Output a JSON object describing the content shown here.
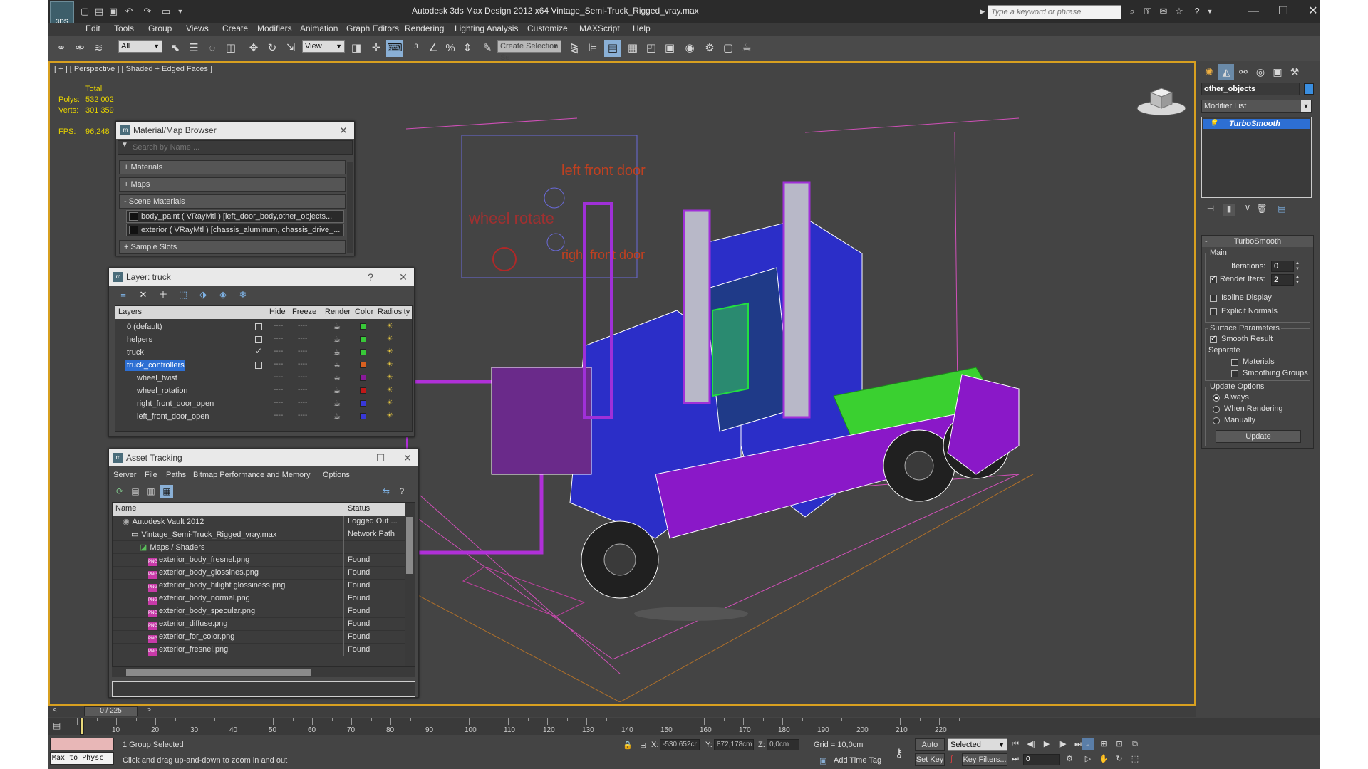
{
  "titlebar": {
    "title": "Autodesk 3ds Max Design 2012 x64      Vintage_Semi-Truck_Rigged_vray.max",
    "search_placeholder": "Type a keyword or phrase",
    "logo_text": "3DS"
  },
  "menu": [
    "Edit",
    "Tools",
    "Group",
    "Views",
    "Create",
    "Modifiers",
    "Animation",
    "Graph Editors",
    "Rendering",
    "Lighting Analysis",
    "Customize",
    "MAXScript",
    "Help"
  ],
  "toolbar": {
    "selection_filter": "All",
    "reference_coord": "View",
    "named_selection": "Create Selection Se"
  },
  "viewport": {
    "label": "[ + ] [ Perspective ] [ Shaded + Edged Faces ]",
    "stats": {
      "header": "Total",
      "polys_label": "Polys:",
      "polys_value": "532 002",
      "verts_label": "Verts:",
      "verts_value": "301 359",
      "fps_label": "FPS:",
      "fps_value": "96,248"
    },
    "annotations": {
      "left_front_door": "left front door",
      "wheel_rotate": "wheel rotate",
      "right_front_door": "right front door"
    }
  },
  "material_browser": {
    "title": "Material/Map Browser",
    "search_placeholder": "Search by Name ...",
    "sections": [
      "+ Materials",
      "+ Maps",
      "- Scene Materials",
      "+ Sample Slots"
    ],
    "scene_materials": [
      "body_paint ( VRayMtl ) [left_door_body,other_objects...",
      "exterior ( VRayMtl ) [chassis_aluminum, chassis_drive_..."
    ]
  },
  "layer_manager": {
    "title": "Layer: truck",
    "help": "?",
    "columns": [
      "Layers",
      "Hide",
      "Freeze",
      "Render",
      "Color",
      "Radiosity"
    ],
    "rows": [
      {
        "name": "0 (default)",
        "color": "#38c838",
        "indent": 0,
        "state": "box"
      },
      {
        "name": "helpers",
        "color": "#38c838",
        "indent": 0,
        "state": "box"
      },
      {
        "name": "truck",
        "color": "#38c838",
        "indent": 0,
        "state": "check"
      },
      {
        "name": "truck_controllers",
        "color": "#d86020",
        "indent": 0,
        "state": "box"
      },
      {
        "name": "wheel_twist",
        "color": "#8a1a9a",
        "indent": 1,
        "state": ""
      },
      {
        "name": "wheel_rotation",
        "color": "#c01818",
        "indent": 1,
        "state": ""
      },
      {
        "name": "right_front_door_open",
        "color": "#3838d8",
        "indent": 1,
        "state": ""
      },
      {
        "name": "left_front_door_open",
        "color": "#3838d8",
        "indent": 1,
        "state": ""
      }
    ]
  },
  "asset_tracking": {
    "title": "Asset Tracking",
    "menu": [
      "Server",
      "File",
      "Paths",
      "Bitmap Performance and Memory",
      "Options"
    ],
    "columns": [
      "Name",
      "Status"
    ],
    "rows": [
      {
        "name": "Autodesk Vault 2012",
        "status": "Logged Out ...",
        "indent": 1,
        "kind": "vault"
      },
      {
        "name": "Vintage_Semi-Truck_Rigged_vray.max",
        "status": "Network Path",
        "indent": 2,
        "kind": "file"
      },
      {
        "name": "Maps / Shaders",
        "status": "",
        "indent": 3,
        "kind": "folder"
      },
      {
        "name": "exterior_body_fresnel.png",
        "status": "Found",
        "indent": 4,
        "kind": "png"
      },
      {
        "name": "exterior_body_glossines.png",
        "status": "Found",
        "indent": 4,
        "kind": "png"
      },
      {
        "name": "exterior_body_hilight glossiness.png",
        "status": "Found",
        "indent": 4,
        "kind": "png"
      },
      {
        "name": "exterior_body_normal.png",
        "status": "Found",
        "indent": 4,
        "kind": "png"
      },
      {
        "name": "exterior_body_specular.png",
        "status": "Found",
        "indent": 4,
        "kind": "png"
      },
      {
        "name": "exterior_diffuse.png",
        "status": "Found",
        "indent": 4,
        "kind": "png"
      },
      {
        "name": "exterior_for_color.png",
        "status": "Found",
        "indent": 4,
        "kind": "png"
      },
      {
        "name": "exterior_fresnel.png",
        "status": "Found",
        "indent": 4,
        "kind": "png"
      }
    ]
  },
  "command_panel": {
    "object_name": "other_objects",
    "object_color": "#3a8ee0",
    "modifier_list": "Modifier List",
    "stack_item": "TurboSmooth",
    "turbosmooth": {
      "title": "TurboSmooth",
      "main_group": "Main",
      "iterations_label": "Iterations:",
      "iterations_value": "0",
      "render_iters_label": "Render Iters:",
      "render_iters_value": "2",
      "isoline_label": "Isoline Display",
      "explicit_normals_label": "Explicit Normals",
      "surface_group": "Surface Parameters",
      "smooth_result_label": "Smooth Result",
      "separate_label": "Separate",
      "materials_label": "Materials",
      "smoothing_groups_label": "Smoothing Groups",
      "update_group": "Update Options",
      "always_label": "Always",
      "when_rendering_label": "When Rendering",
      "manually_label": "Manually",
      "update_button": "Update"
    }
  },
  "timeline": {
    "frame_display": "0 / 225",
    "ticks": [
      "10",
      "20",
      "30",
      "40",
      "50",
      "60",
      "70",
      "80",
      "90",
      "100",
      "110",
      "120",
      "130",
      "140",
      "150",
      "160",
      "170",
      "180",
      "190",
      "200",
      "210",
      "220"
    ]
  },
  "statusbar": {
    "script_text": "Max to Physc",
    "selection_status": "1 Group Selected",
    "prompt": "Click and drag up-and-down to zoom in and out",
    "x_label": "X:",
    "x_value": "-530,652cr",
    "y_label": "Y:",
    "y_value": "872,178cm",
    "z_label": "Z:",
    "z_value": "0,0cm",
    "grid": "Grid = 10,0cm",
    "add_time_tag": "Add Time Tag",
    "auto_key": "Auto Key",
    "set_key": "Set Key",
    "key_mode": "Selected",
    "key_filters": "Key Filters...",
    "current_frame": "0"
  }
}
